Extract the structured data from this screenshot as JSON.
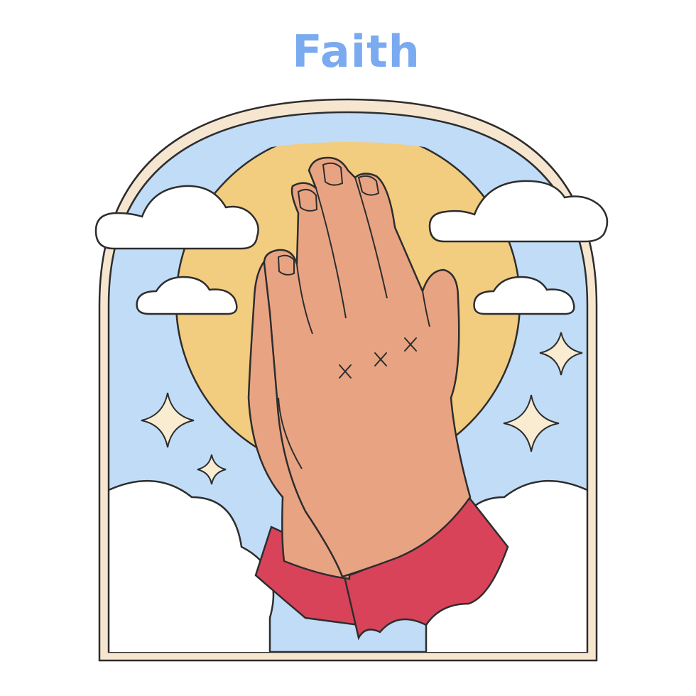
{
  "title": "Faith",
  "colors": {
    "title": "#7aaaf0",
    "frame": "#f7e6cf",
    "sky": "#c0dcf7",
    "sun": "#f2cc7f",
    "cloud": "#ffffff",
    "skin": "#e8a482",
    "sleeve": "#d9435a",
    "star": "#faecd0",
    "outline": "#2d2d2d"
  },
  "illustration": {
    "subject": "praying-hands",
    "marks_on_hand": "x x x"
  }
}
